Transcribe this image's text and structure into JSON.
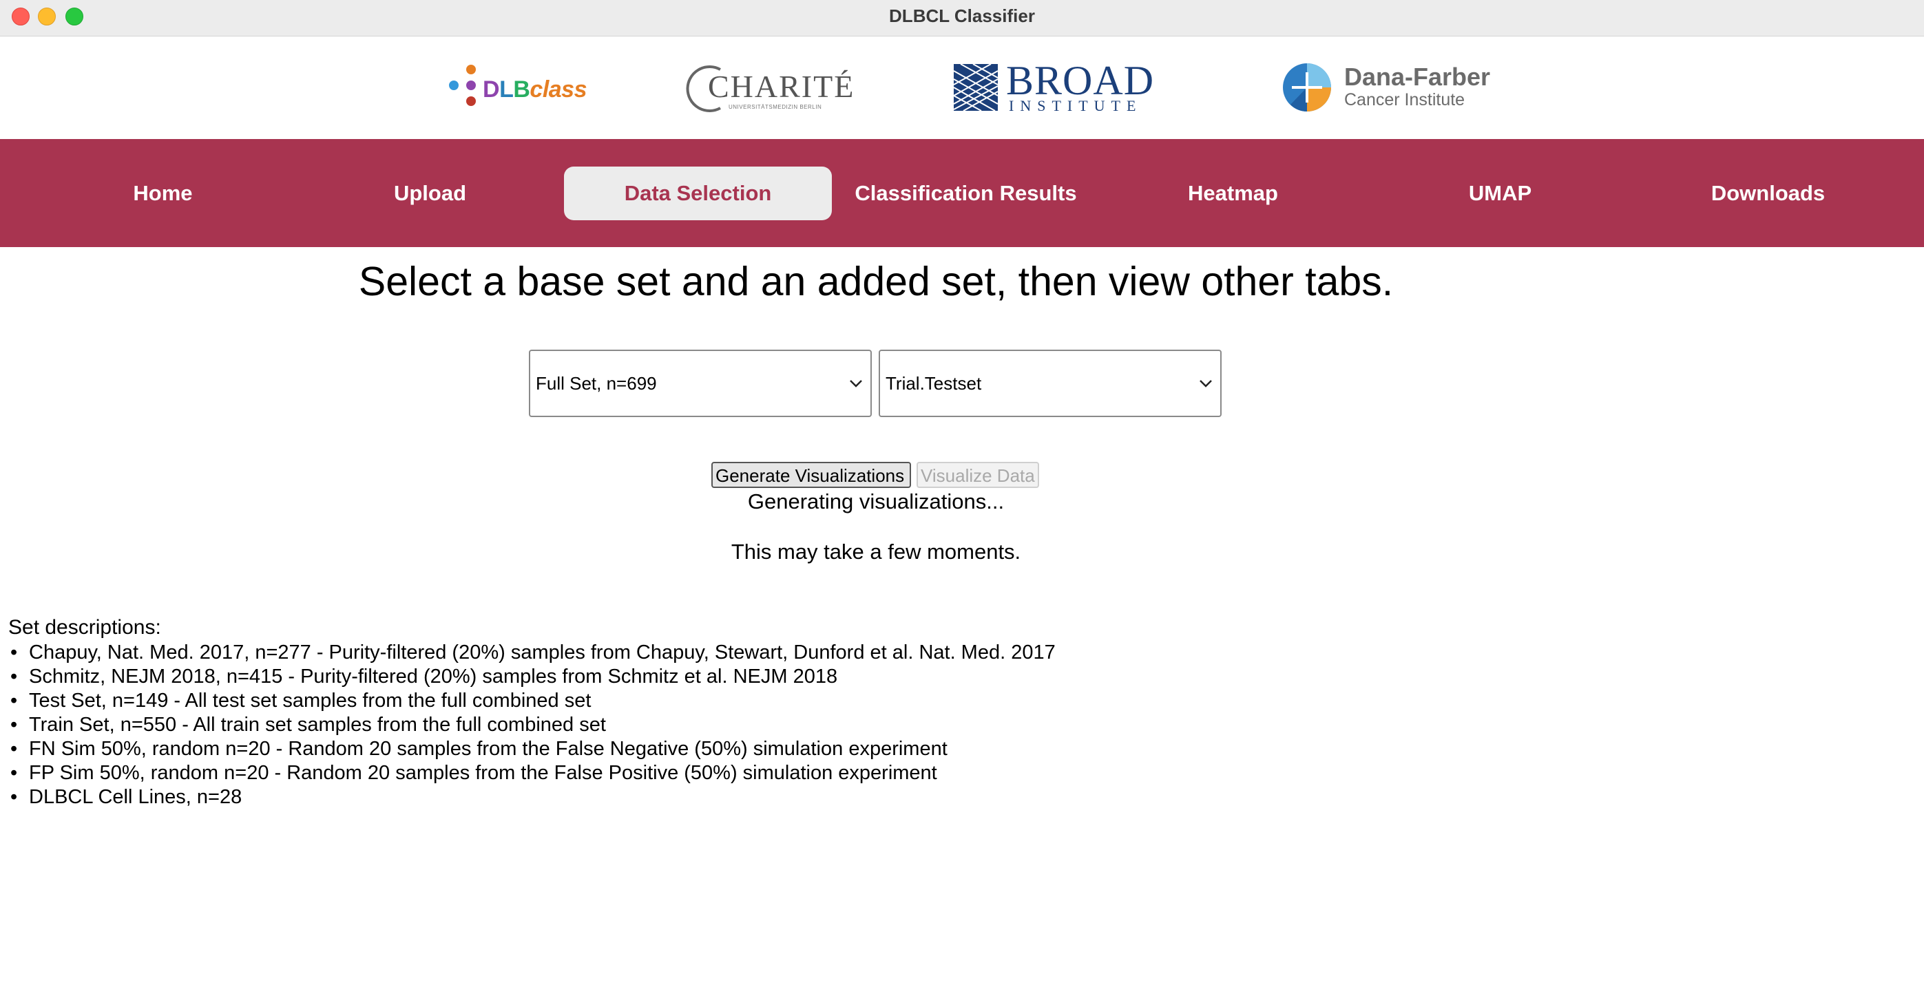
{
  "window": {
    "title": "DLBCL Classifier"
  },
  "logos": {
    "dlbclass": {
      "word_d": "D",
      "word_l": "L",
      "word_b": "B",
      "word_class": "class"
    },
    "charite": {
      "name": "CHARITÉ",
      "sub": "UNIVERSITÄTSMEDIZIN BERLIN"
    },
    "broad": {
      "name": "BROAD",
      "sub": "INSTITUTE"
    },
    "dana_farber": {
      "name": "Dana-Farber",
      "sub": "Cancer Institute"
    }
  },
  "nav": {
    "items": [
      {
        "label": "Home"
      },
      {
        "label": "Upload"
      },
      {
        "label": "Data Selection"
      },
      {
        "label": "Classification Results"
      },
      {
        "label": "Heatmap"
      },
      {
        "label": "UMAP"
      },
      {
        "label": "Downloads"
      }
    ],
    "active_index": 2
  },
  "main": {
    "headline": "Select a base set and an added set, then view other tabs.",
    "base_select": {
      "value": "Full Set, n=699"
    },
    "added_select": {
      "value": "Trial.Testset"
    },
    "generate_button": "Generate Visualizations",
    "visualize_button": "Visualize Data",
    "status_1": "Generating visualizations...",
    "status_2": "This may take a few moments."
  },
  "descriptions": {
    "title": "Set descriptions:",
    "items": [
      "Chapuy, Nat. Med. 2017, n=277 - Purity-filtered (20%) samples from Chapuy, Stewart, Dunford et al. Nat. Med. 2017",
      "Schmitz, NEJM 2018, n=415 - Purity-filtered (20%) samples from Schmitz et al. NEJM 2018",
      "Test Set, n=149 - All test set samples from the full combined set",
      "Train Set, n=550 - All train set samples from the full combined set",
      "FN Sim 50%, random n=20 - Random 20 samples from the False Negative (50%) simulation experiment",
      "FP Sim 50%, random n=20 - Random 20 samples from the False Positive (50%) simulation experiment",
      "DLBCL Cell Lines, n=28"
    ]
  },
  "colors": {
    "nav_background": "#a83450",
    "nav_active_background": "#ececec",
    "nav_active_text": "#a83450"
  }
}
